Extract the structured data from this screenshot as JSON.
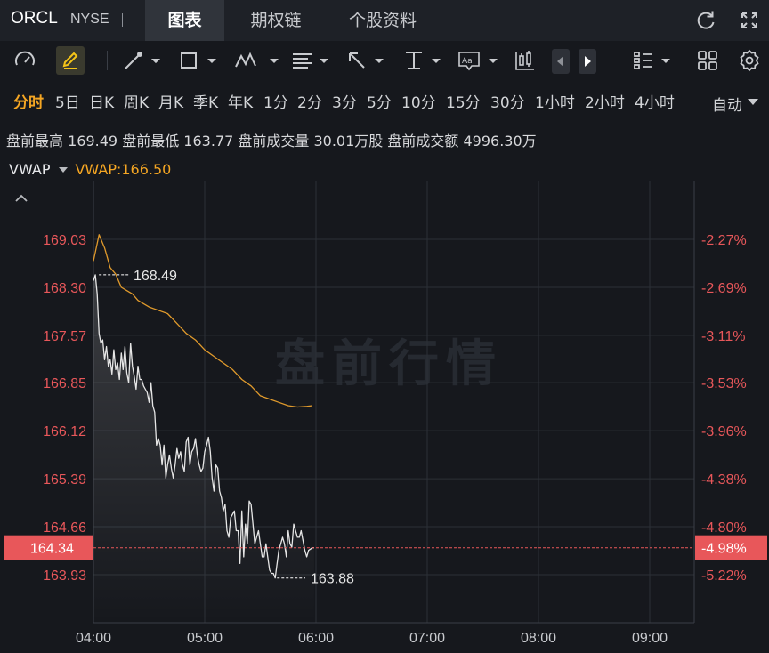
{
  "header": {
    "ticker": "ORCL",
    "exchange": "NYSE",
    "tabs": [
      {
        "label": "图表",
        "active": true
      },
      {
        "label": "期权链",
        "active": false
      },
      {
        "label": "个股资料",
        "active": false
      }
    ],
    "icons": [
      "refresh-icon",
      "fullscreen-icon"
    ]
  },
  "toolbar": {
    "icons": [
      "speedometer-icon",
      "pen-icon",
      "line-tool-icon",
      "rectangle-tool-icon",
      "wave-tool-icon",
      "fib-tool-icon",
      "arrow-tool-icon",
      "text-cursor-icon",
      "text-box-icon",
      "candle-icon",
      "prev-icon",
      "next-icon",
      "layout-list-icon",
      "grid-icon",
      "settings-icon"
    ]
  },
  "periods": {
    "items": [
      "分时",
      "5日",
      "日K",
      "周K",
      "月K",
      "季K",
      "年K",
      "1分",
      "2分",
      "3分",
      "5分",
      "10分",
      "15分",
      "30分",
      "1小时",
      "2小时",
      "4小时"
    ],
    "active": "分时",
    "mode": "自动"
  },
  "stats": {
    "high_label": "盘前最高",
    "high": "169.49",
    "low_label": "盘前最低",
    "low": "163.77",
    "volume_label": "盘前成交量",
    "volume": "30.01万股",
    "amount_label": "盘前成交额",
    "amount": "4996.30万"
  },
  "legend": {
    "indicator": "VWAP",
    "value_text": "VWAP:166.50"
  },
  "watermark": "盘前行情",
  "colors": {
    "accent": "#f5a623",
    "price_line": "#e6e6e6",
    "vwap_line": "#e09a2c",
    "axis_red": "#e8575a",
    "current_bg": "#e8575a"
  },
  "chart_data": {
    "type": "line",
    "y_ticks": [
      "169.03",
      "168.30",
      "167.57",
      "166.85",
      "166.12",
      "165.39",
      "164.66",
      "163.93"
    ],
    "pct_ticks": [
      "-2.27%",
      "-2.69%",
      "-3.11%",
      "-3.53%",
      "-3.96%",
      "-4.38%",
      "-4.80%",
      "-5.22%"
    ],
    "x_ticks": [
      "04:00",
      "05:00",
      "06:00",
      "07:00",
      "08:00",
      "09:00"
    ],
    "ylim": [
      163.5,
      169.8
    ],
    "xlim_minutes": [
      0,
      324
    ],
    "current_price": "164.34",
    "current_pct": "-4.98%",
    "high_marker": {
      "label": "168.49",
      "t": 2,
      "v": 168.49
    },
    "low_marker": {
      "label": "163.88",
      "t": 99,
      "v": 163.88
    },
    "series": [
      {
        "key": "price",
        "t": [
          0,
          1,
          2,
          3,
          4,
          5,
          6,
          7,
          8,
          9,
          10,
          11,
          12,
          13,
          14,
          15,
          16,
          17,
          18,
          19,
          20,
          21,
          22,
          23,
          24,
          25,
          26,
          27,
          28,
          29,
          30,
          31,
          32,
          33,
          34,
          35,
          36,
          37,
          38,
          39,
          40,
          41,
          42,
          43,
          44,
          45,
          46,
          47,
          48,
          49,
          50,
          51,
          52,
          53,
          54,
          55,
          56,
          57,
          58,
          59,
          60,
          61,
          62,
          63,
          64,
          65,
          66,
          67,
          68,
          69,
          70,
          71,
          72,
          73,
          74,
          75,
          76,
          77,
          78,
          79,
          80,
          81,
          82,
          83,
          84,
          85,
          86,
          87,
          88,
          89,
          90,
          91,
          92,
          93,
          94,
          95,
          96,
          97,
          98,
          99,
          100,
          101,
          102,
          103,
          104,
          105,
          106,
          107,
          108,
          109,
          110,
          111,
          112,
          113,
          114,
          115,
          116,
          117,
          118,
          119
        ],
        "values": [
          168.4,
          168.49,
          168.2,
          167.6,
          167.45,
          167.5,
          167.2,
          167.4,
          167.1,
          167.2,
          166.98,
          167.35,
          167.05,
          167.15,
          166.9,
          167.3,
          167.05,
          167.4,
          167.0,
          166.85,
          167.45,
          167.1,
          166.95,
          166.75,
          167.1,
          166.9,
          166.9,
          166.8,
          166.75,
          166.7,
          166.55,
          166.85,
          166.5,
          166.4,
          165.9,
          166.0,
          165.9,
          165.6,
          165.9,
          165.4,
          165.6,
          165.75,
          165.55,
          165.4,
          165.6,
          165.85,
          165.7,
          165.8,
          165.6,
          165.5,
          165.95,
          166.02,
          165.6,
          165.8,
          165.85,
          166.0,
          165.75,
          165.6,
          165.5,
          165.55,
          165.8,
          165.9,
          166.02,
          165.8,
          165.4,
          165.2,
          165.6,
          165.55,
          165.2,
          165.1,
          164.9,
          165.0,
          164.6,
          164.5,
          164.8,
          164.85,
          164.9,
          164.6,
          164.6,
          164.1,
          164.9,
          164.2,
          164.7,
          164.4,
          165.05,
          165.0,
          164.7,
          164.4,
          164.5,
          164.6,
          164.4,
          164.2,
          164.2,
          164.4,
          164.2,
          164.0,
          163.95,
          163.95,
          163.88,
          164.1,
          164.3,
          164.4,
          164.5,
          164.4,
          164.2,
          164.6,
          164.4,
          164.35,
          164.7,
          164.6,
          164.5,
          164.5,
          164.6,
          164.45,
          164.3,
          164.2,
          164.3,
          164.32,
          164.34,
          164.34
        ],
        "t_used": 120
      },
      {
        "key": "vwap",
        "t": [
          0,
          3,
          6,
          9,
          12,
          15,
          18,
          21,
          24,
          27,
          30,
          35,
          40,
          45,
          50,
          55,
          60,
          65,
          70,
          75,
          80,
          85,
          90,
          95,
          100,
          105,
          110,
          115,
          118
        ],
        "values": [
          168.7,
          169.1,
          168.9,
          168.6,
          168.5,
          168.3,
          168.25,
          168.2,
          168.1,
          168.05,
          168.0,
          167.95,
          167.9,
          167.75,
          167.6,
          167.5,
          167.35,
          167.25,
          167.15,
          167.05,
          166.9,
          166.8,
          166.65,
          166.6,
          166.55,
          166.5,
          166.48,
          166.49,
          166.5
        ]
      }
    ]
  }
}
